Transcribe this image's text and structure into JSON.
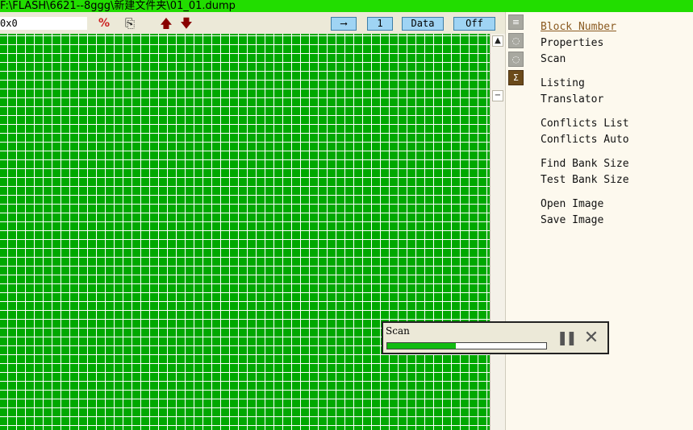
{
  "window": {
    "title": "F:\\FLASH\\6621--8ggg\\新建文件夹\\01_01.dump"
  },
  "toolbar": {
    "address_value": "0x0",
    "icons": {
      "percent": "%",
      "copy": "⎘",
      "up": "🡅",
      "down": "🡇"
    },
    "arrow_label": "⟶",
    "step_label": "1",
    "mode_label": "Data",
    "toggle_label": "Off"
  },
  "scrollbar": {
    "up_label": "▲",
    "minus_label": "−"
  },
  "side_tabs": {
    "tab1_glyph": "≡",
    "tab2_glyph": "◌",
    "tab3_glyph": "◌",
    "tab4_glyph": "Σ"
  },
  "menu": {
    "block_number": "Block Number",
    "properties": "Properties",
    "scan": "Scan",
    "listing": "Listing",
    "translator": "Translator",
    "conflicts_list": "Conflicts List",
    "conflicts_auto": "Conflicts Auto",
    "find_bank_size": "Find Bank Size",
    "test_bank_size": "Test Bank Size",
    "open_image": "Open Image",
    "save_image": "Save Image"
  },
  "scan_dialog": {
    "title": "Scan",
    "progress": 0.43,
    "pause_glyph": "❚❚",
    "close_glyph": "✕"
  },
  "colors": {
    "title_bar": "#22dd00",
    "grid_fill": "#00a800",
    "progress": "#11bb11",
    "pill_fill": "#9fd4f4"
  }
}
